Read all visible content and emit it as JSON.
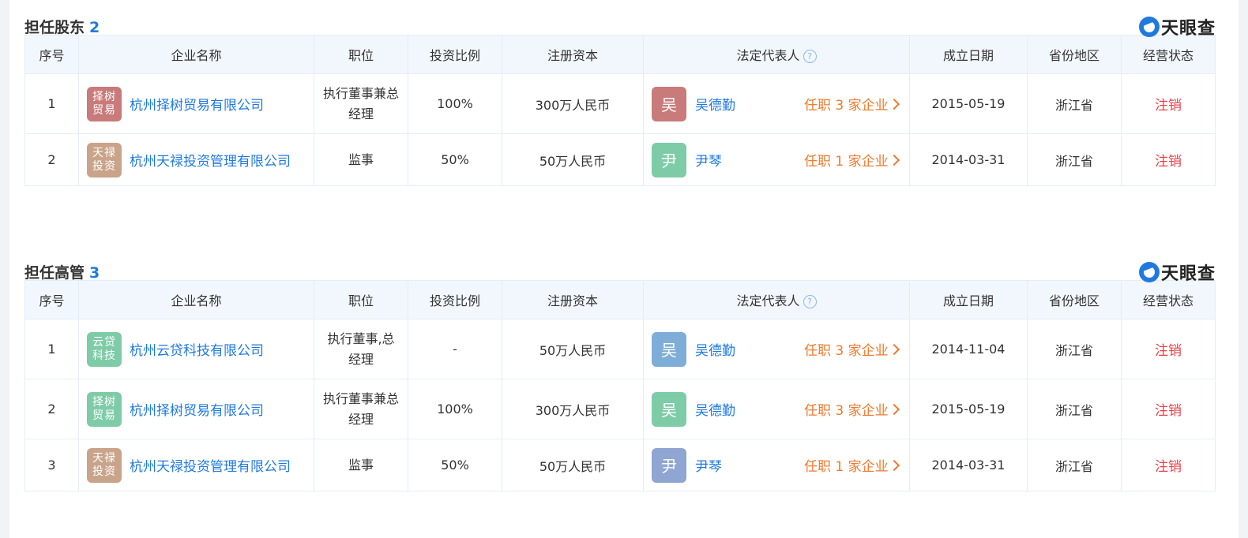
{
  "colors": {
    "accent": "#1f7ae0",
    "orange": "#f07a2c",
    "status_red": "#e8414a",
    "header_bg": "#f2f7fd"
  },
  "brand": {
    "name": "天眼查",
    "icon": "tianyancha-logo-icon"
  },
  "columns": {
    "index": "序号",
    "company": "企业名称",
    "position": "职位",
    "ratio": "投资比例",
    "capital": "注册资本",
    "legal": "法定代表人",
    "help_icon": "?",
    "date": "成立日期",
    "region": "省份地区",
    "status": "经营状态"
  },
  "sections": [
    {
      "title": "担任股东",
      "count": "2",
      "rows": [
        {
          "index": "1",
          "logo": "择树\n贸易",
          "logo_color": "#c97a7a",
          "company": "杭州择树贸易有限公司",
          "position": "执行董事兼总经理",
          "ratio": "100%",
          "capital": "300万人民币",
          "avatar": "吴",
          "avatar_color": "#c97a7a",
          "person": "吴德勤",
          "roles": "任职 3 家企业",
          "date": "2015-05-19",
          "region": "浙江省",
          "status": "注销"
        },
        {
          "index": "2",
          "logo": "天禄\n投资",
          "logo_color": "#c9a48a",
          "company": "杭州天禄投资管理有限公司",
          "position": "监事",
          "ratio": "50%",
          "capital": "50万人民币",
          "avatar": "尹",
          "avatar_color": "#7ecba8",
          "person": "尹琴",
          "roles": "任职 1 家企业",
          "date": "2014-03-31",
          "region": "浙江省",
          "status": "注销"
        }
      ]
    },
    {
      "title": "担任高管",
      "count": "3",
      "rows": [
        {
          "index": "1",
          "logo": "云贷\n科技",
          "logo_color": "#7ecba8",
          "company": "杭州云贷科技有限公司",
          "position": "执行董事,总经理",
          "ratio": "-",
          "capital": "50万人民币",
          "avatar": "吴",
          "avatar_color": "#7eaed8",
          "person": "吴德勤",
          "roles": "任职 3 家企业",
          "date": "2014-11-04",
          "region": "浙江省",
          "status": "注销"
        },
        {
          "index": "2",
          "logo": "择树\n贸易",
          "logo_color": "#7ecba8",
          "company": "杭州择树贸易有限公司",
          "position": "执行董事兼总经理",
          "ratio": "100%",
          "capital": "300万人民币",
          "avatar": "吴",
          "avatar_color": "#7ecba8",
          "person": "吴德勤",
          "roles": "任职 3 家企业",
          "date": "2015-05-19",
          "region": "浙江省",
          "status": "注销"
        },
        {
          "index": "3",
          "logo": "天禄\n投资",
          "logo_color": "#c9a48a",
          "company": "杭州天禄投资管理有限公司",
          "position": "监事",
          "ratio": "50%",
          "capital": "50万人民币",
          "avatar": "尹",
          "avatar_color": "#8fa5d2",
          "person": "尹琴",
          "roles": "任职 1 家企业",
          "date": "2014-03-31",
          "region": "浙江省",
          "status": "注销"
        }
      ]
    }
  ]
}
